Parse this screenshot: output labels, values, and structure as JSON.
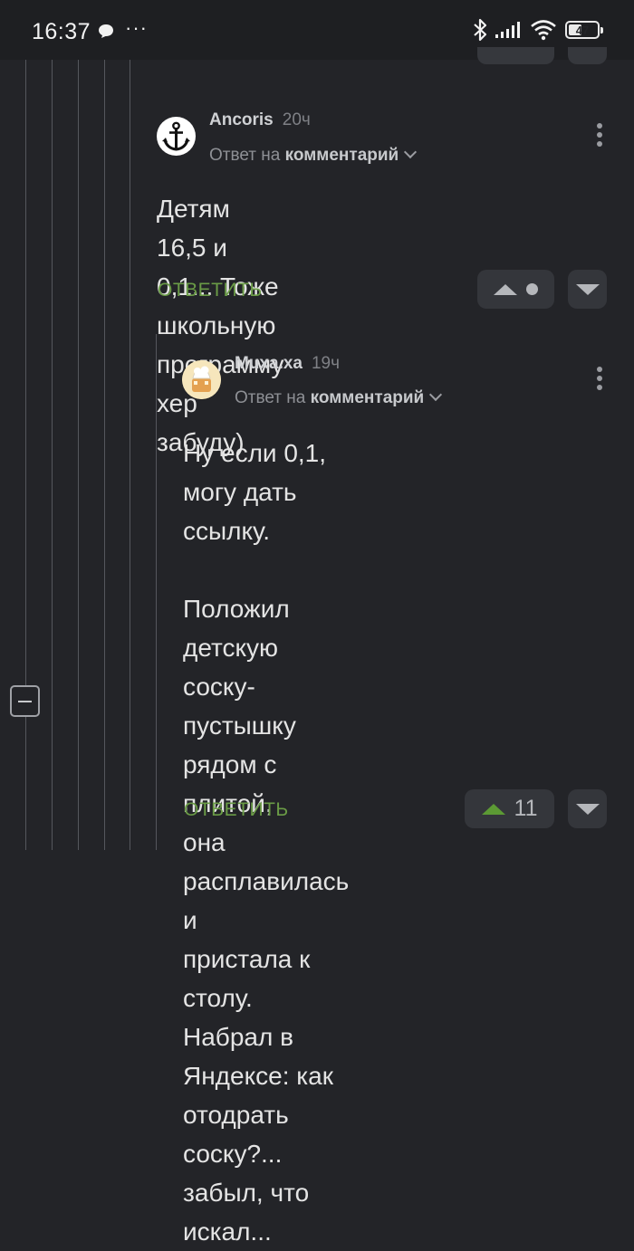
{
  "status_bar": {
    "time": "16:37",
    "dots": "···",
    "battery": "47",
    "battery_level": 0.47,
    "icons": [
      "chat-bubble-icon",
      "bluetooth-icon",
      "signal-icon",
      "wifi-icon",
      "battery-icon"
    ]
  },
  "comments": [
    {
      "author": "Ancoris",
      "time": "20ч",
      "reply_prefix": "Ответ на",
      "reply_target": "комментарий",
      "text_lines": [
        "Детям 16,5 и 0,1... Тоже школьную",
        "программу хер забуду)"
      ],
      "reply_label": "ОТВЕТИТЬ",
      "rating": "",
      "avatar_icon": "anchor-icon"
    },
    {
      "author": "Muxa.xa",
      "time": "19ч",
      "reply_prefix": "Ответ на",
      "reply_target": "комментарий",
      "text_lines": [
        "Ну если 0,1, могу дать ссылку.",
        "",
        "Положил детскую",
        "соску-пустышку рядом с плитой,",
        "она расплавилась и",
        "пристала к столу. Набрал в",
        "Яндексе: как отодрать соску?...",
        "забыл, что",
        "искал..."
      ],
      "reply_label": "ОТВЕТИТЬ",
      "rating": "11",
      "avatar_icon": "cartoon-avatar-icon"
    }
  ],
  "colors": {
    "background": "#232428",
    "accent_green": "#6a9b46",
    "upvote_green": "#5c9a34",
    "button_bg": "#34363b"
  }
}
